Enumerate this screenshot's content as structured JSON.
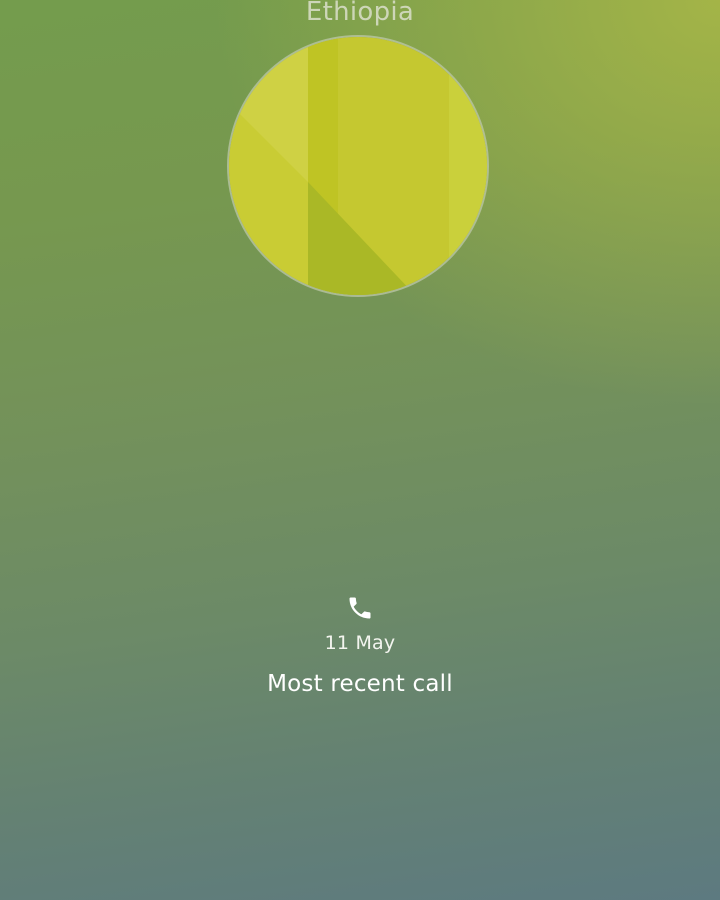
{
  "contact": {
    "name": "Ethiopia",
    "avatar_colors": {
      "left_light": "#cfd144",
      "left_mid": "#c9cc34",
      "right_main": "#c5c830",
      "center_strip": "#bcc21e",
      "shadow": "#aab826",
      "right_edge": "#cdd140"
    }
  },
  "call_log": {
    "icon": "phone-icon",
    "date": "11 May",
    "caption": "Most recent call"
  }
}
